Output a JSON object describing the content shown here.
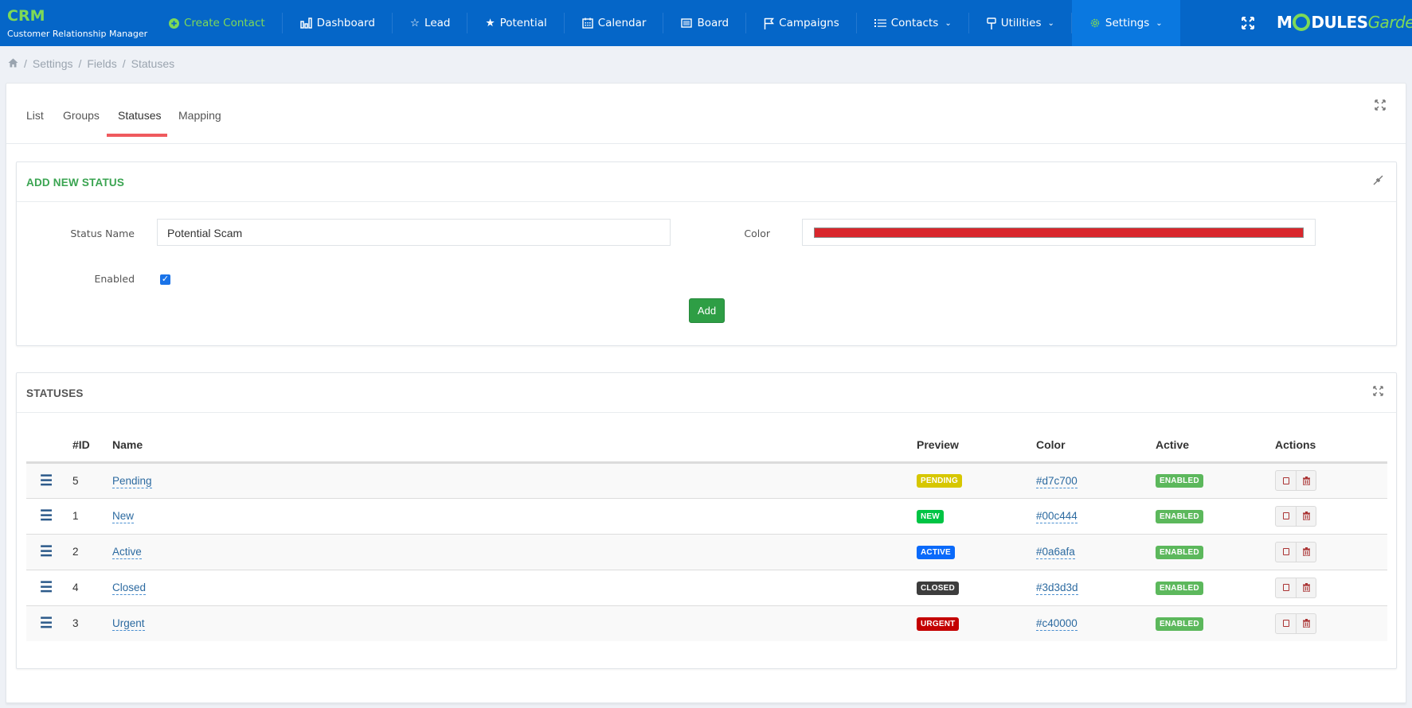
{
  "app": {
    "title": "CRM",
    "subtitle": "Customer Relationship Manager",
    "logo_main": "MODULES",
    "logo_accent": "Garden"
  },
  "nav": [
    {
      "label": "Create Contact",
      "icon": "plus-circle-icon"
    },
    {
      "label": "Dashboard",
      "icon": "bar-chart-icon"
    },
    {
      "label": "Lead",
      "icon": "star-outline-icon"
    },
    {
      "label": "Potential",
      "icon": "star-icon"
    },
    {
      "label": "Calendar",
      "icon": "calendar-icon"
    },
    {
      "label": "Board",
      "icon": "board-icon"
    },
    {
      "label": "Campaigns",
      "icon": "flag-icon"
    },
    {
      "label": "Contacts",
      "icon": "list-icon",
      "dropdown": true
    },
    {
      "label": "Utilities",
      "icon": "signpost-icon",
      "dropdown": true
    },
    {
      "label": "Settings",
      "icon": "gear-icon",
      "dropdown": true,
      "active": true
    }
  ],
  "breadcrumb": [
    "Settings",
    "Fields",
    "Statuses"
  ],
  "tabs": [
    {
      "label": "List"
    },
    {
      "label": "Groups"
    },
    {
      "label": "Statuses",
      "active": true
    },
    {
      "label": "Mapping"
    }
  ],
  "add_form": {
    "title": "ADD NEW STATUS",
    "status_name_label": "Status Name",
    "status_name_value": "Potential Scam",
    "color_label": "Color",
    "color_value": "#d9262c",
    "enabled_label": "Enabled",
    "enabled_checked": true,
    "add_button": "Add"
  },
  "statuses_table": {
    "title": "STATUSES",
    "columns": [
      "#ID",
      "Name",
      "Preview",
      "Color",
      "Active",
      "Actions"
    ],
    "rows": [
      {
        "id": "5",
        "name": "Pending",
        "preview": "PENDING",
        "color": "#d7c700",
        "active": "ENABLED"
      },
      {
        "id": "1",
        "name": "New",
        "preview": "NEW",
        "color": "#00c444",
        "active": "ENABLED"
      },
      {
        "id": "2",
        "name": "Active",
        "preview": "ACTIVE",
        "color": "#0a6afa",
        "active": "ENABLED"
      },
      {
        "id": "4",
        "name": "Closed",
        "preview": "CLOSED",
        "color": "#3d3d3d",
        "active": "ENABLED"
      },
      {
        "id": "3",
        "name": "Urgent",
        "preview": "URGENT",
        "color": "#c40000",
        "active": "ENABLED"
      }
    ]
  },
  "colors": {
    "topbar": "#0566c8",
    "accent_green": "#7ed957",
    "tab_underline": "#ef5a5e",
    "add_button": "#2e9e45",
    "enabled_badge": "#5cb85c"
  }
}
